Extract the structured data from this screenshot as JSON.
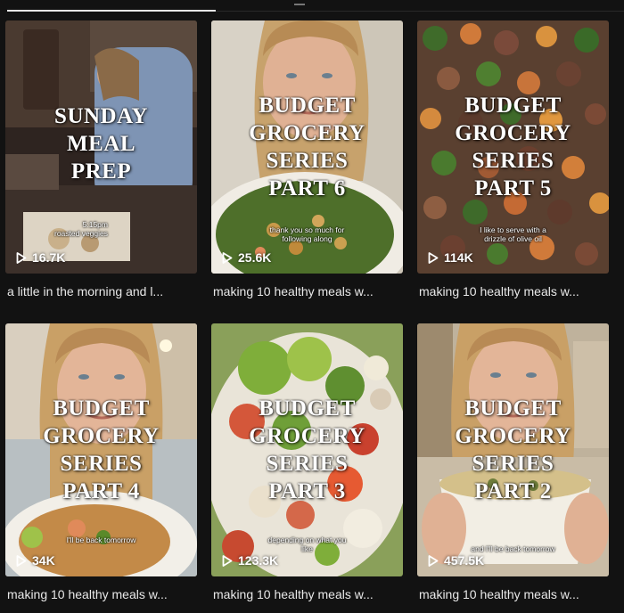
{
  "videos": [
    {
      "title": "a little in the morning and l...",
      "overlay": "SUNDAY\nMEAL\nPREP",
      "caption": "5:15pm\nroasted veggies",
      "views": "16.7K",
      "colors": [
        "#3a2e28",
        "#6b5a4c",
        "#8e9fb5",
        "#2c2522"
      ]
    },
    {
      "title": "making 10 healthy meals w...",
      "overlay": "BUDGET\nGROCERY\nSERIES\nPART 6",
      "caption": "thank you so much for\nfollowing along",
      "views": "25.6K",
      "colors": [
        "#c8bfb0",
        "#d6a88a",
        "#4f6e2a",
        "#e8e4dc"
      ]
    },
    {
      "title": "making 10 healthy meals w...",
      "overlay": "BUDGET\nGROCERY\nSERIES\nPART 5",
      "caption": "I like to serve with a\ndrizzle of olive oil",
      "views": "114K",
      "colors": [
        "#6b4a33",
        "#b56b3a",
        "#3f6b2a",
        "#5a3a2a"
      ]
    },
    {
      "title": "making 10 healthy meals w...",
      "overlay": "BUDGET\nGROCERY\nSERIES\nPART 4",
      "caption": "I'll be back tomorrow",
      "views": "34K",
      "colors": [
        "#d8cdbd",
        "#d6a88a",
        "#c28a4a",
        "#e6e2da"
      ]
    },
    {
      "title": "making 10 healthy meals w...",
      "overlay": "BUDGET\nGROCERY\nSERIES\nPART 3",
      "caption": "depending on what you\nlike",
      "views": "123.3K",
      "colors": [
        "#5f8f3a",
        "#d4573a",
        "#e9e4d8",
        "#8db04a"
      ]
    },
    {
      "title": "making 10 healthy meals w...",
      "overlay": "BUDGET\nGROCERY\nSERIES\nPART 2",
      "caption": "and I'll be back tomorrow",
      "views": "457.5K",
      "colors": [
        "#b9a890",
        "#d6a88a",
        "#e8e2d4",
        "#6e7d3a"
      ]
    }
  ]
}
